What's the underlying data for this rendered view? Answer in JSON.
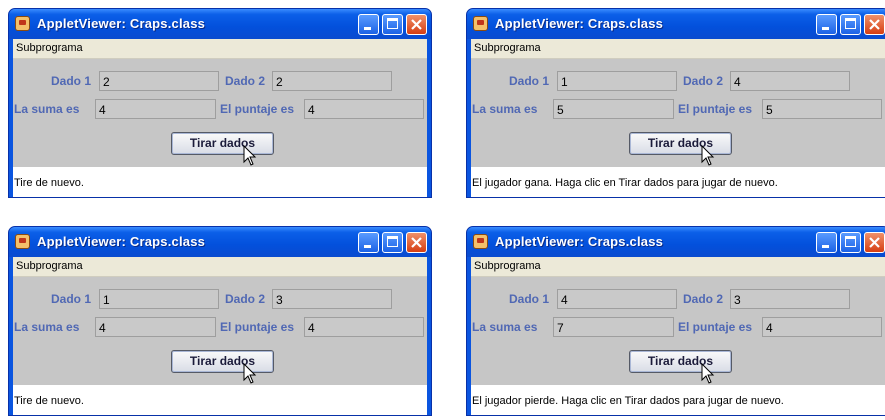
{
  "windows": [
    {
      "title": "AppletViewer: Craps.class",
      "menu": "Subprograma",
      "die1_label": "Dado 1",
      "die1_value": "2",
      "die2_label": "Dado 2",
      "die2_value": "2",
      "sum_label": "La suma es",
      "sum_value": "4",
      "point_label": "El puntaje es",
      "point_value": "4",
      "button_label": "Tirar dados",
      "status": "Tire de nuevo."
    },
    {
      "title": "AppletViewer: Craps.class",
      "menu": "Subprograma",
      "die1_label": "Dado 1",
      "die1_value": "1",
      "die2_label": "Dado 2",
      "die2_value": "4",
      "sum_label": "La suma es",
      "sum_value": "5",
      "point_label": "El puntaje es",
      "point_value": "5",
      "button_label": "Tirar dados",
      "status": "El jugador gana. Haga clic en Tirar dados para jugar de nuevo."
    },
    {
      "title": "AppletViewer: Craps.class",
      "menu": "Subprograma",
      "die1_label": "Dado 1",
      "die1_value": "1",
      "die2_label": "Dado 2",
      "die2_value": "3",
      "sum_label": "La suma es",
      "sum_value": "4",
      "point_label": "El puntaje es",
      "point_value": "4",
      "button_label": "Tirar dados",
      "status": "Tire de nuevo."
    },
    {
      "title": "AppletViewer: Craps.class",
      "menu": "Subprograma",
      "die1_label": "Dado 1",
      "die1_value": "4",
      "die2_label": "Dado 2",
      "die2_value": "3",
      "sum_label": "La suma es",
      "sum_value": "7",
      "point_label": "El puntaje es",
      "point_value": "4",
      "button_label": "Tirar dados",
      "status": "El jugador pierde. Haga clic en Tirar dados para jugar de nuevo."
    }
  ],
  "colors": {
    "title_bar": "#0a55e0",
    "panel": "#c6c6c6",
    "label_text": "#5068b4",
    "close_button": "#d63e12"
  },
  "icons": [
    "applet-icon",
    "minimize-icon",
    "maximize-icon",
    "close-icon",
    "mouse-pointer-icon"
  ]
}
